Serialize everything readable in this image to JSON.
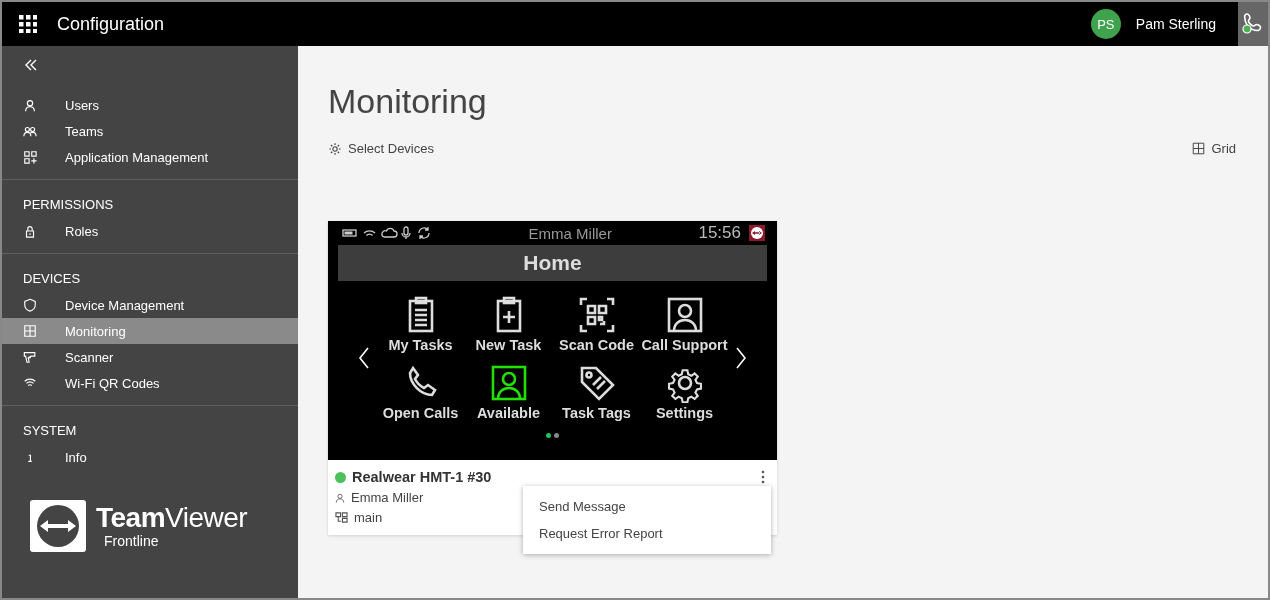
{
  "topbar": {
    "title": "Configuration",
    "user": {
      "initials": "PS",
      "name": "Pam Sterling"
    }
  },
  "sidebar": {
    "sections": [
      {
        "items": [
          {
            "label": "Users",
            "selected": false
          },
          {
            "label": "Teams",
            "selected": false
          },
          {
            "label": "Application Management",
            "selected": false
          }
        ]
      },
      {
        "header": "PERMISSIONS",
        "items": [
          {
            "label": "Roles",
            "selected": false
          }
        ]
      },
      {
        "header": "DEVICES",
        "items": [
          {
            "label": "Device Management",
            "selected": false
          },
          {
            "label": "Monitoring",
            "selected": true
          },
          {
            "label": "Scanner",
            "selected": false
          },
          {
            "label": "Wi-Fi QR Codes",
            "selected": false
          }
        ]
      },
      {
        "header": "SYSTEM",
        "items": [
          {
            "label": "Info",
            "selected": false
          }
        ]
      }
    ],
    "logo": {
      "name_bold": "Team",
      "name_light": "Viewer",
      "sub": "Frontline"
    }
  },
  "page": {
    "title": "Monitoring",
    "select_devices": "Select Devices",
    "view": "Grid"
  },
  "device": {
    "screen": {
      "user": "Emma Miller",
      "time": "15:56",
      "heading": "Home",
      "apps": [
        {
          "label": "My Tasks",
          "selected": false
        },
        {
          "label": "New Task",
          "selected": false
        },
        {
          "label": "Scan Code",
          "selected": false
        },
        {
          "label": "Call Support",
          "selected": false
        },
        {
          "label": "Open Calls",
          "selected": false
        },
        {
          "label": "Available",
          "selected": true
        },
        {
          "label": "Task Tags",
          "selected": false
        },
        {
          "label": "Settings",
          "selected": false
        }
      ],
      "pages": [
        {
          "selected": true
        },
        {
          "selected": false
        }
      ]
    },
    "name": "Realwear HMT-1 #30",
    "online": true,
    "user": "Emma Miller",
    "group": "main",
    "menu": [
      "Send Message",
      "Request Error Report"
    ]
  }
}
